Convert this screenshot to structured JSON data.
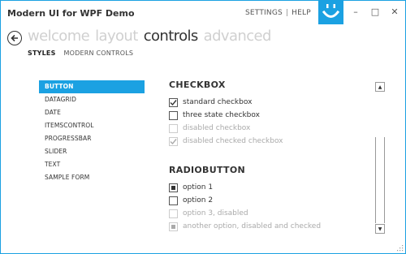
{
  "window": {
    "title": "Modern UI for WPF Demo",
    "accent": "#1ba1e2"
  },
  "top_links": [
    {
      "label": "SETTINGS"
    },
    {
      "label": "HELP"
    }
  ],
  "top_links_sep": "|",
  "window_controls": {
    "minimize": "–",
    "maximize": "□",
    "close": "✕"
  },
  "main_nav": [
    {
      "label": "welcome",
      "active": false
    },
    {
      "label": "layout",
      "active": false
    },
    {
      "label": "controls",
      "active": true
    },
    {
      "label": "advanced",
      "active": false
    }
  ],
  "sub_nav": [
    {
      "label": "STYLES",
      "active": true
    },
    {
      "label": "MODERN CONTROLS",
      "active": false
    }
  ],
  "left_list": [
    {
      "label": "BUTTON",
      "selected": true
    },
    {
      "label": "DATAGRID",
      "selected": false
    },
    {
      "label": "DATE",
      "selected": false
    },
    {
      "label": "ITEMSCONTROL",
      "selected": false
    },
    {
      "label": "PROGRESSBAR",
      "selected": false
    },
    {
      "label": "SLIDER",
      "selected": false
    },
    {
      "label": "TEXT",
      "selected": false
    },
    {
      "label": "SAMPLE FORM",
      "selected": false
    }
  ],
  "checkbox_section": {
    "heading": "CHECKBOX",
    "items": [
      {
        "label": "standard checkbox",
        "checked": true,
        "disabled": false
      },
      {
        "label": "three state checkbox",
        "checked": false,
        "disabled": false
      },
      {
        "label": "disabled checkbox",
        "checked": false,
        "disabled": true
      },
      {
        "label": "disabled checked checkbox",
        "checked": true,
        "disabled": true
      }
    ]
  },
  "radio_section": {
    "heading": "RADIOBUTTON",
    "items": [
      {
        "label": "option 1",
        "checked": true,
        "disabled": false
      },
      {
        "label": "option 2",
        "checked": false,
        "disabled": false
      },
      {
        "label": "option 3, disabled",
        "checked": false,
        "disabled": true
      },
      {
        "label": "another option, disabled and checked",
        "checked": true,
        "disabled": true
      }
    ]
  },
  "scrollbar": {
    "up_glyph": "▲",
    "down_glyph": "▼"
  }
}
